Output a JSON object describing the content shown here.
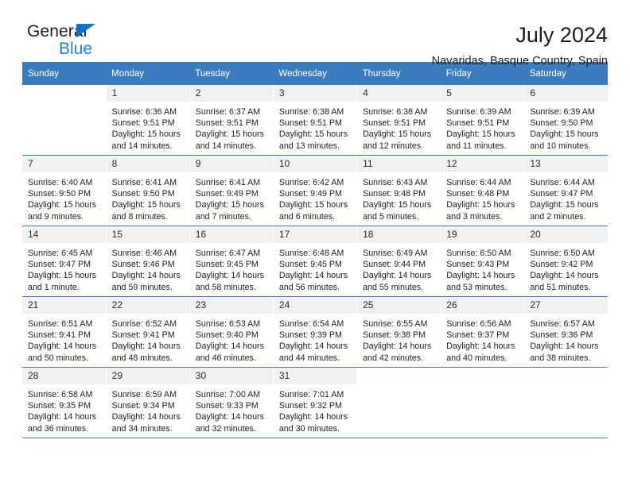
{
  "brand": {
    "name_top": "General",
    "name_bottom": "Blue",
    "triangle_color": "#1273c4",
    "blue_text_color": "#1f7fd0"
  },
  "header": {
    "title": "July 2024",
    "subtitle": "Navaridas, Basque Country, Spain"
  },
  "theme": {
    "header_blue": "#3b7cbe",
    "daynum_background": "#f1f1f1",
    "page_background": "#ffffff"
  },
  "calendar": {
    "weekday_headers": [
      "Sunday",
      "Monday",
      "Tuesday",
      "Wednesday",
      "Thursday",
      "Friday",
      "Saturday"
    ],
    "weeks": [
      [
        {
          "day": "",
          "lines": []
        },
        {
          "day": "1",
          "lines": [
            "Sunrise: 6:36 AM",
            "Sunset: 9:51 PM",
            "Daylight: 15 hours",
            "and 14 minutes."
          ]
        },
        {
          "day": "2",
          "lines": [
            "Sunrise: 6:37 AM",
            "Sunset: 9:51 PM",
            "Daylight: 15 hours",
            "and 14 minutes."
          ]
        },
        {
          "day": "3",
          "lines": [
            "Sunrise: 6:38 AM",
            "Sunset: 9:51 PM",
            "Daylight: 15 hours",
            "and 13 minutes."
          ]
        },
        {
          "day": "4",
          "lines": [
            "Sunrise: 6:38 AM",
            "Sunset: 9:51 PM",
            "Daylight: 15 hours",
            "and 12 minutes."
          ]
        },
        {
          "day": "5",
          "lines": [
            "Sunrise: 6:39 AM",
            "Sunset: 9:51 PM",
            "Daylight: 15 hours",
            "and 11 minutes."
          ]
        },
        {
          "day": "6",
          "lines": [
            "Sunrise: 6:39 AM",
            "Sunset: 9:50 PM",
            "Daylight: 15 hours",
            "and 10 minutes."
          ]
        }
      ],
      [
        {
          "day": "7",
          "lines": [
            "Sunrise: 6:40 AM",
            "Sunset: 9:50 PM",
            "Daylight: 15 hours",
            "and 9 minutes."
          ]
        },
        {
          "day": "8",
          "lines": [
            "Sunrise: 6:41 AM",
            "Sunset: 9:50 PM",
            "Daylight: 15 hours",
            "and 8 minutes."
          ]
        },
        {
          "day": "9",
          "lines": [
            "Sunrise: 6:41 AM",
            "Sunset: 9:49 PM",
            "Daylight: 15 hours",
            "and 7 minutes."
          ]
        },
        {
          "day": "10",
          "lines": [
            "Sunrise: 6:42 AM",
            "Sunset: 9:49 PM",
            "Daylight: 15 hours",
            "and 6 minutes."
          ]
        },
        {
          "day": "11",
          "lines": [
            "Sunrise: 6:43 AM",
            "Sunset: 9:48 PM",
            "Daylight: 15 hours",
            "and 5 minutes."
          ]
        },
        {
          "day": "12",
          "lines": [
            "Sunrise: 6:44 AM",
            "Sunset: 9:48 PM",
            "Daylight: 15 hours",
            "and 3 minutes."
          ]
        },
        {
          "day": "13",
          "lines": [
            "Sunrise: 6:44 AM",
            "Sunset: 9:47 PM",
            "Daylight: 15 hours",
            "and 2 minutes."
          ]
        }
      ],
      [
        {
          "day": "14",
          "lines": [
            "Sunrise: 6:45 AM",
            "Sunset: 9:47 PM",
            "Daylight: 15 hours",
            "and 1 minute."
          ]
        },
        {
          "day": "15",
          "lines": [
            "Sunrise: 6:46 AM",
            "Sunset: 9:46 PM",
            "Daylight: 14 hours",
            "and 59 minutes."
          ]
        },
        {
          "day": "16",
          "lines": [
            "Sunrise: 6:47 AM",
            "Sunset: 9:45 PM",
            "Daylight: 14 hours",
            "and 58 minutes."
          ]
        },
        {
          "day": "17",
          "lines": [
            "Sunrise: 6:48 AM",
            "Sunset: 9:45 PM",
            "Daylight: 14 hours",
            "and 56 minutes."
          ]
        },
        {
          "day": "18",
          "lines": [
            "Sunrise: 6:49 AM",
            "Sunset: 9:44 PM",
            "Daylight: 14 hours",
            "and 55 minutes."
          ]
        },
        {
          "day": "19",
          "lines": [
            "Sunrise: 6:50 AM",
            "Sunset: 9:43 PM",
            "Daylight: 14 hours",
            "and 53 minutes."
          ]
        },
        {
          "day": "20",
          "lines": [
            "Sunrise: 6:50 AM",
            "Sunset: 9:42 PM",
            "Daylight: 14 hours",
            "and 51 minutes."
          ]
        }
      ],
      [
        {
          "day": "21",
          "lines": [
            "Sunrise: 6:51 AM",
            "Sunset: 9:41 PM",
            "Daylight: 14 hours",
            "and 50 minutes."
          ]
        },
        {
          "day": "22",
          "lines": [
            "Sunrise: 6:52 AM",
            "Sunset: 9:41 PM",
            "Daylight: 14 hours",
            "and 48 minutes."
          ]
        },
        {
          "day": "23",
          "lines": [
            "Sunrise: 6:53 AM",
            "Sunset: 9:40 PM",
            "Daylight: 14 hours",
            "and 46 minutes."
          ]
        },
        {
          "day": "24",
          "lines": [
            "Sunrise: 6:54 AM",
            "Sunset: 9:39 PM",
            "Daylight: 14 hours",
            "and 44 minutes."
          ]
        },
        {
          "day": "25",
          "lines": [
            "Sunrise: 6:55 AM",
            "Sunset: 9:38 PM",
            "Daylight: 14 hours",
            "and 42 minutes."
          ]
        },
        {
          "day": "26",
          "lines": [
            "Sunrise: 6:56 AM",
            "Sunset: 9:37 PM",
            "Daylight: 14 hours",
            "and 40 minutes."
          ]
        },
        {
          "day": "27",
          "lines": [
            "Sunrise: 6:57 AM",
            "Sunset: 9:36 PM",
            "Daylight: 14 hours",
            "and 38 minutes."
          ]
        }
      ],
      [
        {
          "day": "28",
          "lines": [
            "Sunrise: 6:58 AM",
            "Sunset: 9:35 PM",
            "Daylight: 14 hours",
            "and 36 minutes."
          ]
        },
        {
          "day": "29",
          "lines": [
            "Sunrise: 6:59 AM",
            "Sunset: 9:34 PM",
            "Daylight: 14 hours",
            "and 34 minutes."
          ]
        },
        {
          "day": "30",
          "lines": [
            "Sunrise: 7:00 AM",
            "Sunset: 9:33 PM",
            "Daylight: 14 hours",
            "and 32 minutes."
          ]
        },
        {
          "day": "31",
          "lines": [
            "Sunrise: 7:01 AM",
            "Sunset: 9:32 PM",
            "Daylight: 14 hours",
            "and 30 minutes."
          ]
        },
        {
          "day": "",
          "lines": []
        },
        {
          "day": "",
          "lines": []
        },
        {
          "day": "",
          "lines": []
        }
      ]
    ]
  }
}
